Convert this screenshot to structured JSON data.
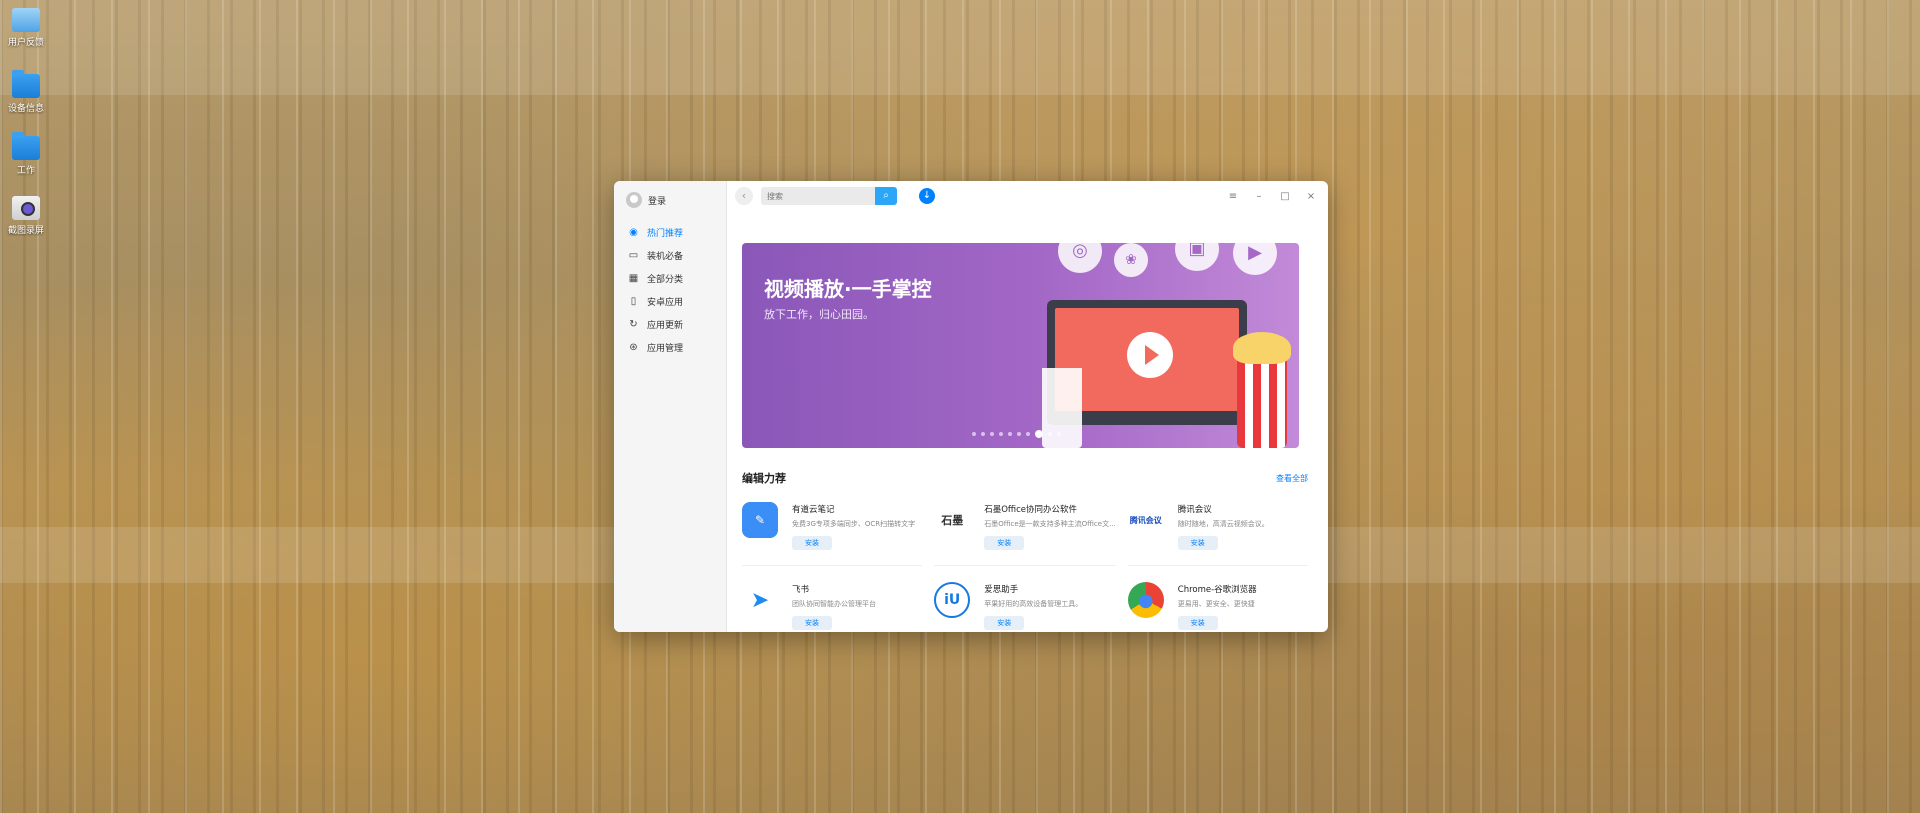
{
  "desktop": {
    "icons": [
      {
        "label": "用户反馈",
        "icon": "feedback-icon"
      },
      {
        "label": "设备信息",
        "icon": "folder-icon"
      },
      {
        "label": "工作",
        "icon": "folder-icon"
      },
      {
        "label": "截图录屏",
        "icon": "camera-icon"
      }
    ]
  },
  "app": {
    "sidebar": {
      "login_label": "登录",
      "items": [
        {
          "label": "热门推荐",
          "icon": "recommend-icon",
          "active": true
        },
        {
          "label": "装机必备",
          "icon": "monitor-icon"
        },
        {
          "label": "全部分类",
          "icon": "grid-icon"
        },
        {
          "label": "安卓应用",
          "icon": "phone-icon"
        },
        {
          "label": "应用更新",
          "icon": "refresh-icon"
        },
        {
          "label": "应用管理",
          "icon": "manage-icon"
        }
      ]
    },
    "titlebar": {
      "search_placeholder": "搜索",
      "menu_glyph": "≡",
      "minimize_glyph": "–",
      "maximize_glyph": "□",
      "close_glyph": "×"
    },
    "banner": {
      "title": "视频播放·一手掌控",
      "subtitle": "放下工作，归心田园。",
      "slide_count": 10,
      "active_slide": 7
    },
    "section": {
      "title": "编辑力荐",
      "view_all": "查看全部"
    },
    "apps": [
      {
        "name": "有道云笔记",
        "desc": "免费3G专项多端同步、OCR扫描转文字",
        "install": "安装",
        "icon_color": "#3a8ef6",
        "icon_glyph": "✎"
      },
      {
        "name": "石墨Office协同办公软件",
        "desc": "石墨Office是一款支持多种主流Office文...",
        "install": "安装",
        "icon_color": "#ffffff",
        "icon_glyph": "石墨"
      },
      {
        "name": "腾讯会议",
        "desc": "随时随地，高清云视频会议。",
        "install": "安装",
        "icon_color": "#ffffff",
        "icon_glyph": "腾讯会议"
      },
      {
        "name": "飞书",
        "desc": "团队协同智能办公管理平台",
        "install": "安装",
        "icon_color": "#ffffff",
        "icon_glyph": "➤"
      },
      {
        "name": "爱思助手",
        "desc": "苹果好用的高效设备管理工具。",
        "install": "安装",
        "icon_color": "#ffffff",
        "icon_glyph": "iU"
      },
      {
        "name": "Chrome-谷歌浏览器",
        "desc": "更易用、更安全、更快捷",
        "install": "安装",
        "icon_color": "#ffffff",
        "icon_glyph": "●"
      }
    ]
  }
}
